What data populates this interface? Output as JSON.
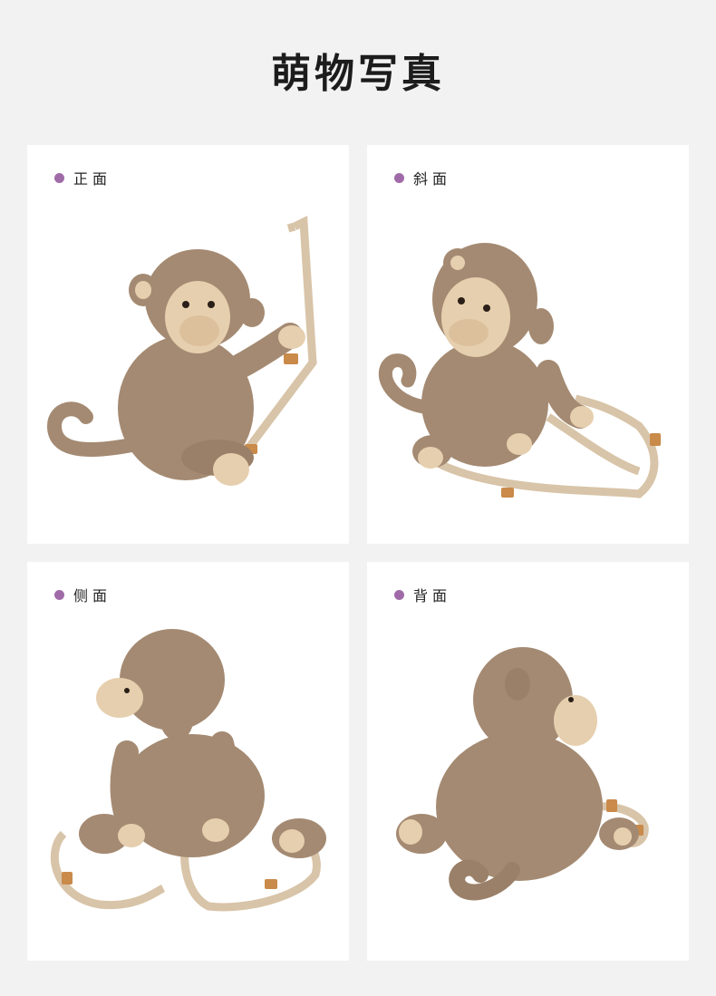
{
  "header": {
    "title": "萌物写真"
  },
  "views": [
    {
      "label": "正面"
    },
    {
      "label": "斜面"
    },
    {
      "label": "侧面"
    },
    {
      "label": "背面"
    }
  ],
  "colors": {
    "page_background": "#f2f2f2",
    "card_background": "#ffffff",
    "bullet": "#a06aa8",
    "fur": "#a48a72",
    "face": "#e6cfae",
    "strap": "#d8c4a8",
    "buckle": "#c98a4a"
  }
}
